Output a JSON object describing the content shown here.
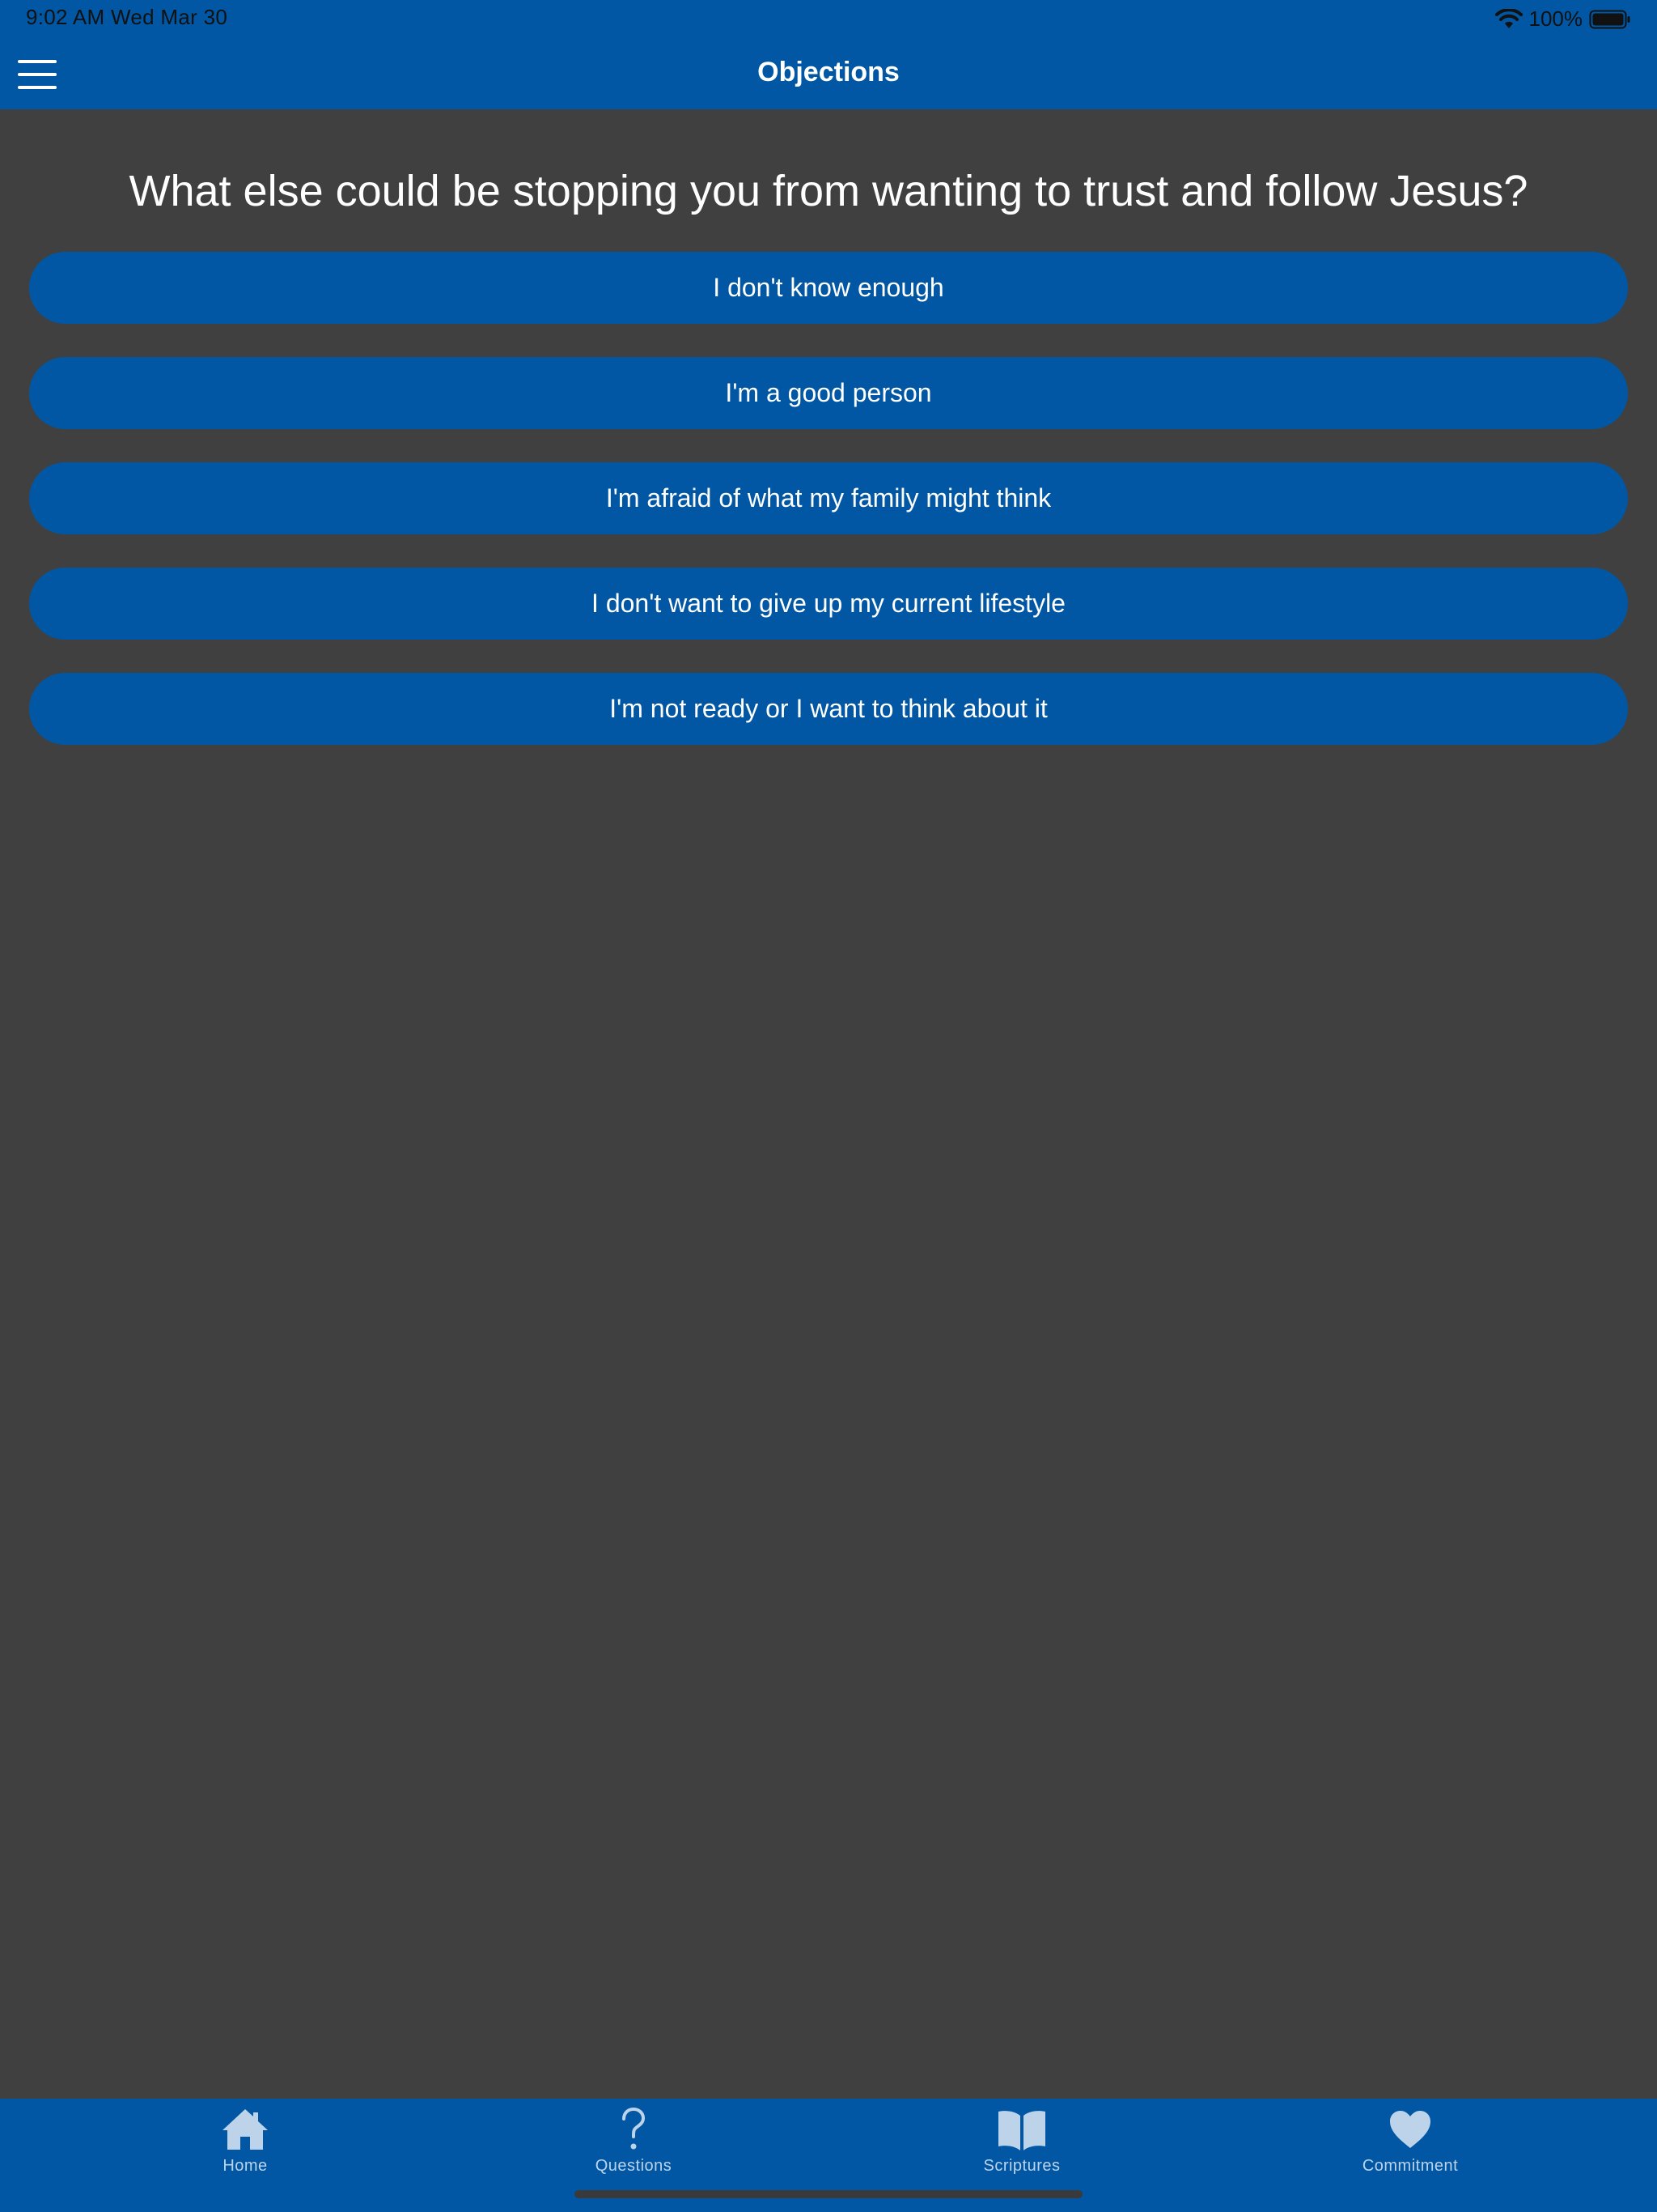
{
  "status_bar": {
    "time_date": "9:02 AM   Wed Mar 30",
    "battery": "100%",
    "text_color": "#111111"
  },
  "nav": {
    "title": "Objections",
    "menu_icon": "hamburger-menu-icon",
    "background": "#0157a3"
  },
  "main": {
    "question": "What else could be stopping you from wanting to trust and follow Jesus?",
    "background": "#404040",
    "answers": [
      "I don't know enough",
      "I'm a good person",
      "I'm afraid of what my family might think",
      "I don't want to give up my current lifestyle",
      "I'm not ready or I want to think about it"
    ],
    "button_color": "#0157a3"
  },
  "tabbar": {
    "background": "#0157a3",
    "item_color": "#bcd3ea",
    "items": [
      {
        "label": "Home",
        "icon": "house-icon"
      },
      {
        "label": "Questions",
        "icon": "question-mark-icon"
      },
      {
        "label": "Scriptures",
        "icon": "open-book-icon"
      },
      {
        "label": "Commitment",
        "icon": "heart-icon"
      }
    ]
  }
}
